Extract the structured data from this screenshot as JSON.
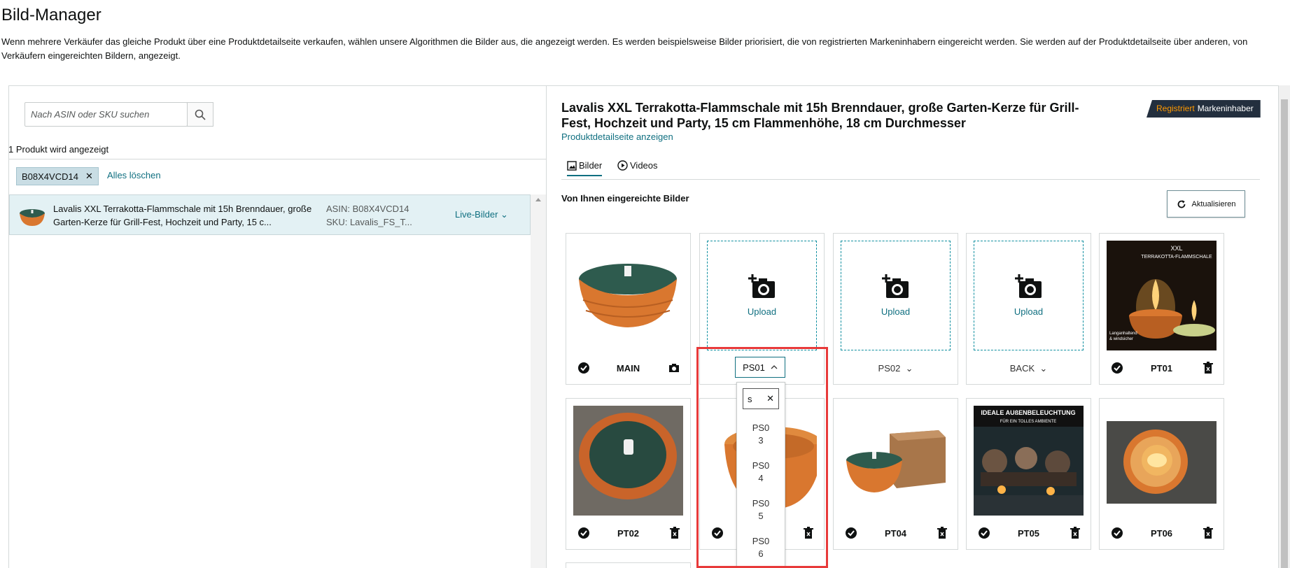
{
  "page": {
    "title": "Bild-Manager",
    "description": "Wenn mehrere Verkäufer das gleiche Produkt über eine Produktdetailseite verkaufen, wählen unsere Algorithmen die Bilder aus, die angezeigt werden. Es werden beispielsweise Bilder priorisiert, die von registrierten Markeninhabern eingereicht werden. Sie werden auf der Produktdetailseite über anderen, von Verkäufern eingereichten Bildern, angezeigt."
  },
  "left": {
    "search_placeholder": "Nach ASIN oder SKU suchen",
    "count_text": "1 Produkt wird angezeigt",
    "chip_label": "B08X4VCD14",
    "clear_all": "Alles löschen",
    "row": {
      "name": "Lavalis XXL Terrakotta-Flammschale mit 15h Brenndauer, große Garten-Kerze für Grill-Fest, Hochzeit und Party, 15 c...",
      "asin": "ASIN: B08X4VCD14",
      "sku": "SKU: Lavalis_FS_T...",
      "status": "Live-Bilder"
    }
  },
  "right": {
    "product_title": "Lavalis XXL Terrakotta-Flammschale mit 15h Brenndauer, große Garten-Kerze für Grill-Fest, Hochzeit und Party, 15 cm Flammenhöhe, 18 cm Durchmesser",
    "detail_link": "Produktdetailseite anzeigen",
    "badge_registered": "Registriert",
    "badge_brand": "Markeninhaber",
    "tabs": [
      "Bilder",
      "Videos"
    ],
    "section_title": "Von Ihnen eingereichte Bilder",
    "refresh_label": "Aktualisieren",
    "upload_label": "Upload",
    "slots": {
      "main": "MAIN",
      "ps01": "PS01",
      "ps02": "PS02",
      "back": "BACK",
      "pt01": "PT01",
      "pt02": "PT02",
      "pt04": "PT04",
      "pt05": "PT05",
      "pt06": "PT06"
    },
    "pt01_image_text": {
      "line1": "XXL",
      "line2": "TERRAKOTTA-FLAMMSCHALE",
      "line3": "Langanhaltend",
      "line4": "& windsicher"
    },
    "pt05_image_text": {
      "line1": "IDEALE AUßENBELEUCHTUNG",
      "line2": "FÜR EIN TOLLES AMBIENTE"
    },
    "dropdown": {
      "search_value": "s",
      "options": [
        [
          "PS0",
          "3"
        ],
        [
          "PS0",
          "4"
        ],
        [
          "PS0",
          "5"
        ],
        [
          "PS0",
          "6"
        ]
      ]
    }
  },
  "colors": {
    "accent": "#0f6f80",
    "highlight": "#e83a3a",
    "terracotta": "#d9772f",
    "wax": "#2e5b4e"
  }
}
